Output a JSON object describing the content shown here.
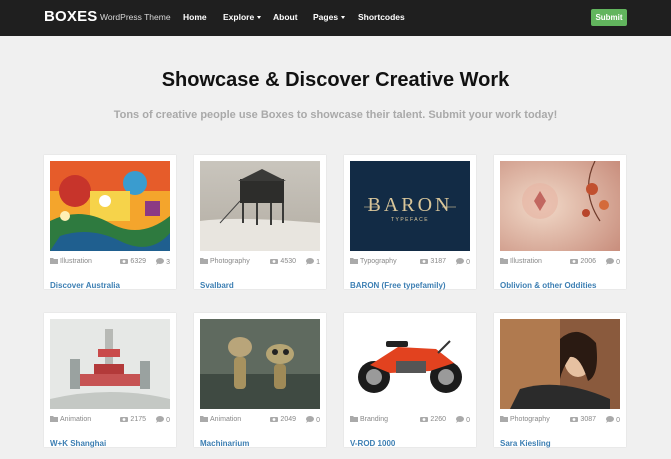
{
  "nav": {
    "logo": "BOXES",
    "tagline": "WordPress Theme",
    "items": [
      {
        "label": "Home"
      },
      {
        "label": "Explore"
      },
      {
        "label": "About"
      },
      {
        "label": "Pages"
      },
      {
        "label": "Shortcodes"
      }
    ],
    "submit": "Submit"
  },
  "hero": {
    "title": "Showcase & Discover Creative Work",
    "subtitle": "Tons of creative people use Boxes to showcase their talent. Submit your work today!"
  },
  "cards": [
    {
      "title": "Discover Australia",
      "category": "Illustration",
      "views": "6329",
      "comments": "3"
    },
    {
      "title": "Svalbard",
      "category": "Photography",
      "views": "4530",
      "comments": "1"
    },
    {
      "title": "BARON (Free typefamily)",
      "category": "Typography",
      "views": "3187",
      "comments": "0",
      "thumb_text": "BARON",
      "thumb_subtext": "TYPEFACE"
    },
    {
      "title": "Oblivion & other Oddities",
      "category": "Illustration",
      "views": "2006",
      "comments": "0"
    },
    {
      "title": "W+K Shanghai",
      "category": "Animation",
      "views": "2175",
      "comments": "0"
    },
    {
      "title": "Machinarium",
      "category": "Animation",
      "views": "2049",
      "comments": "0"
    },
    {
      "title": "V-ROD 1000",
      "category": "Branding",
      "views": "2260",
      "comments": "0"
    },
    {
      "title": "Sara Kiesling",
      "category": "Photography",
      "views": "3087",
      "comments": "0"
    }
  ],
  "colors": {
    "navbar": "#1f1f1f",
    "submit": "#62b55e",
    "link": "#3d7fb3",
    "subtitle": "#a9a9a9"
  }
}
